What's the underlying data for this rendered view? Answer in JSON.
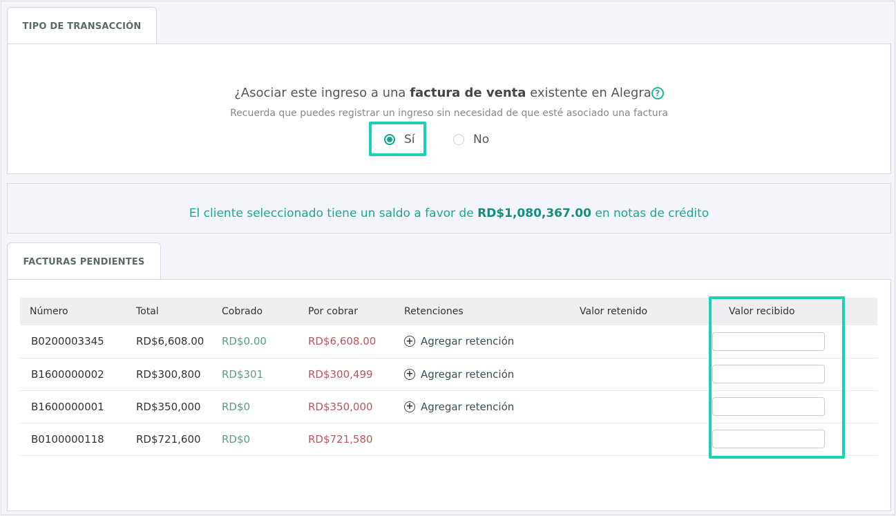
{
  "transaction": {
    "tab_label": "TIPO DE TRANSACCIÓN",
    "question_prefix": "¿Asociar este ingreso a una ",
    "question_bold": "factura de venta",
    "question_suffix": " existente en Alegra",
    "help_glyph": "?",
    "hint": "Recuerda que puedes registrar un ingreso sin necesidad de que esté asociado una factura",
    "option_yes": "Sí",
    "option_no": "No",
    "selected": "Sí"
  },
  "credit": {
    "prefix": "El cliente seleccionado tiene un saldo a favor de ",
    "amount": "RD$1,080,367.00",
    "suffix": " en notas de crédito"
  },
  "invoices": {
    "tab_label": "FACTURAS PENDIENTES",
    "columns": [
      "Número",
      "Total",
      "Cobrado",
      "Por cobrar",
      "Retenciones",
      "Valor retenido",
      "Valor recibido"
    ],
    "add_withholding_label": "Agregar retención",
    "rows": [
      {
        "numero": "B0200003345",
        "total": "RD$6,608.00",
        "cobrado": "RD$0.00",
        "por_cobrar": "RD$6,608.00",
        "retencion": "Agregar retención",
        "valor_retenido": "",
        "valor_recibido": ""
      },
      {
        "numero": "B1600000002",
        "total": "RD$300,800",
        "cobrado": "RD$301",
        "por_cobrar": "RD$300,499",
        "retencion": "Agregar retención",
        "valor_retenido": "",
        "valor_recibido": ""
      },
      {
        "numero": "B1600000001",
        "total": "RD$350,000",
        "cobrado": "RD$0",
        "por_cobrar": "RD$350,000",
        "retencion": "Agregar retención",
        "valor_retenido": "",
        "valor_recibido": ""
      },
      {
        "numero": "B0100000118",
        "total": "RD$721,600",
        "cobrado": "RD$0",
        "por_cobrar": "RD$721,580",
        "retencion": "",
        "valor_retenido": "",
        "valor_recibido": ""
      }
    ]
  },
  "colors": {
    "accent": "#19d2b6",
    "paid_green": "#5aa07a",
    "due_red": "#b85860",
    "credit_teal": "#1aa892"
  },
  "icons": {
    "help": "question-circle-icon",
    "add": "plus-circle-icon"
  }
}
